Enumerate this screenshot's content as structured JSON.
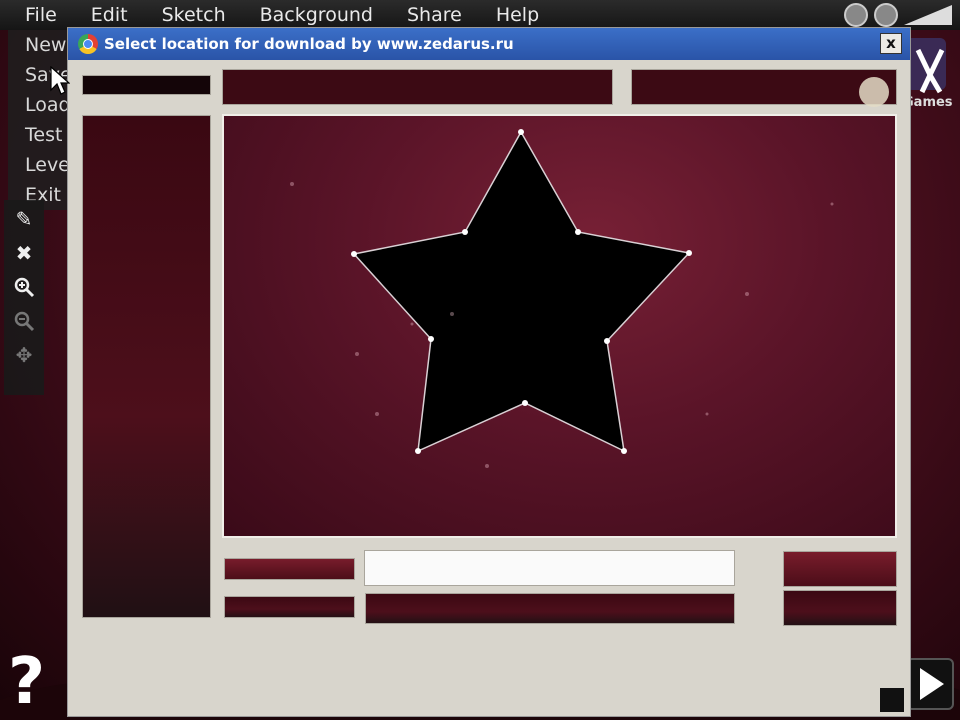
{
  "menubar": {
    "items": [
      "File",
      "Edit",
      "Sketch",
      "Background",
      "Share",
      "Help"
    ]
  },
  "file_menu": {
    "items": [
      "New",
      "Save",
      "Load",
      "Test",
      "Level info",
      "Exit"
    ]
  },
  "logo": {
    "text": "Games"
  },
  "toolbar": {
    "icons": [
      "pencil-icon",
      "delete-icon",
      "zoom-in-icon",
      "zoom-out-icon",
      "move-icon"
    ]
  },
  "help": {
    "label": "?"
  },
  "dialog": {
    "title": "Select location for download by www.zedarus.ru",
    "close_label": "x"
  },
  "colors": {
    "titlebar": "#2a54a8",
    "dialog_bg": "#d8d5cc",
    "night_sky": "#5a1428"
  }
}
